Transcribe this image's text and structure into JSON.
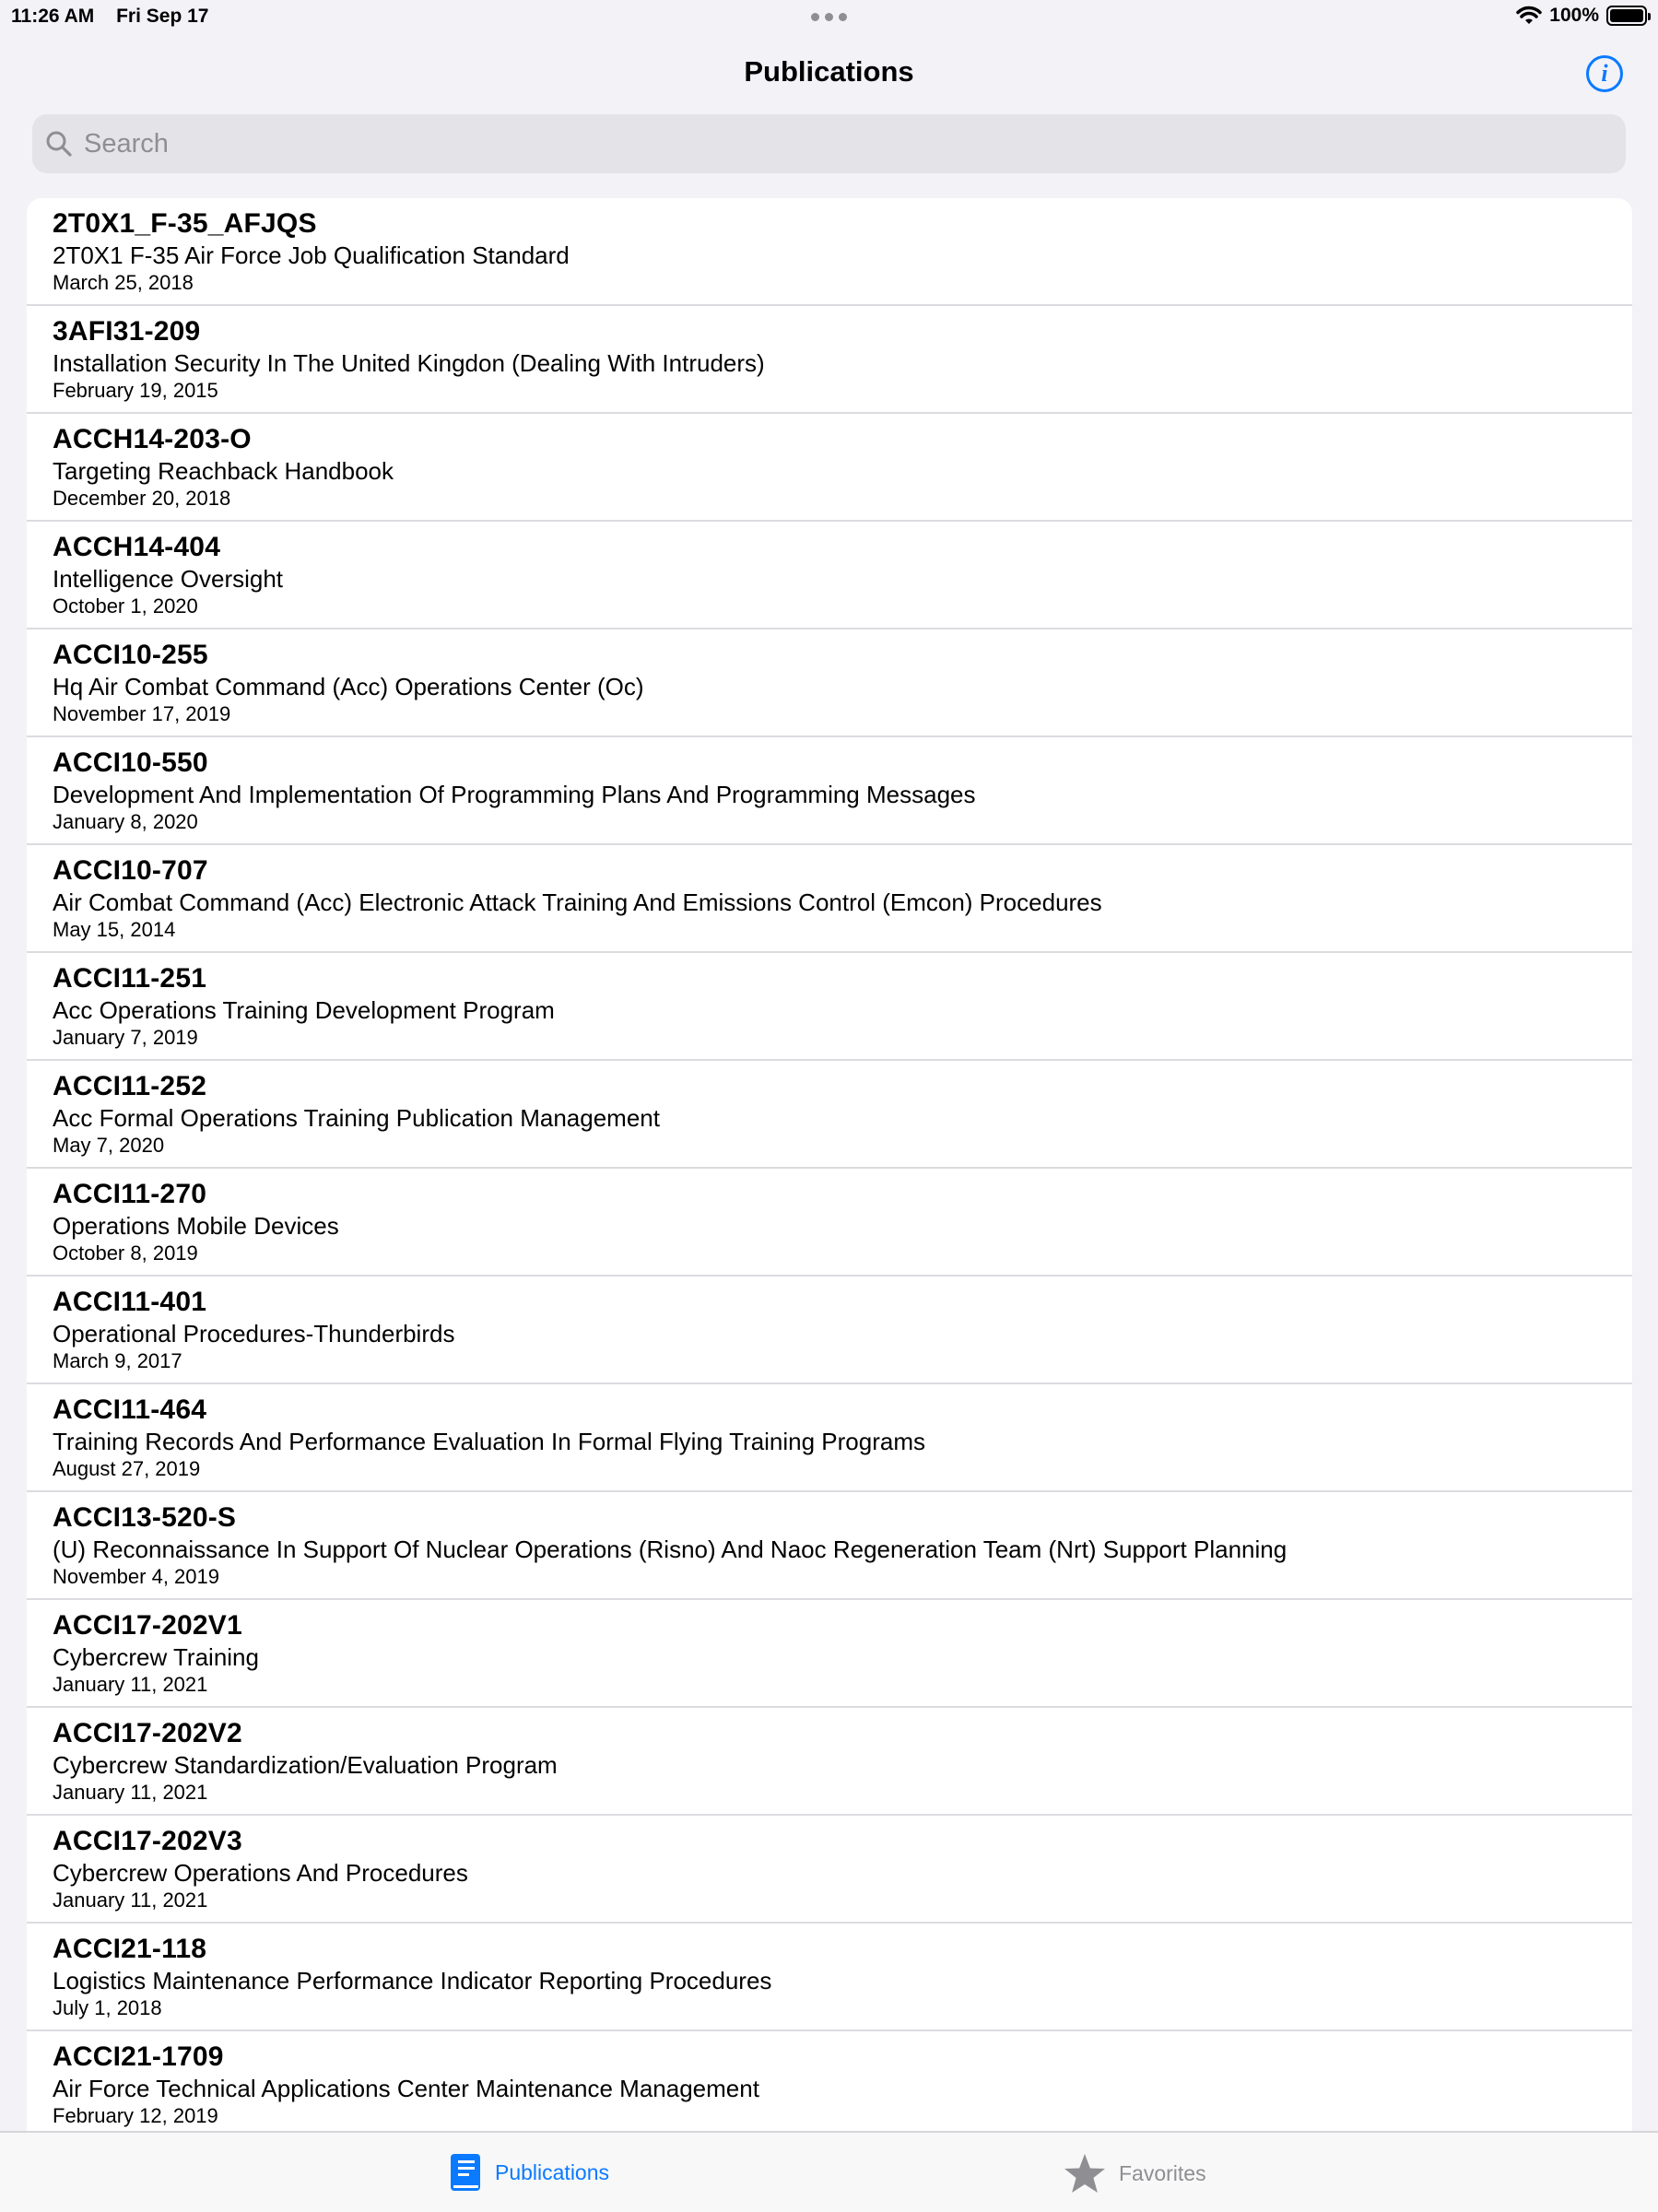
{
  "status_bar": {
    "time": "11:26 AM",
    "date": "Fri Sep 17",
    "battery": "100%"
  },
  "nav": {
    "title": "Publications"
  },
  "search": {
    "placeholder": "Search"
  },
  "publications": [
    {
      "code": "2T0X1_F-35_AFJQS",
      "title": "2T0X1 F-35 Air Force Job Qualification Standard",
      "date": "March 25, 2018"
    },
    {
      "code": "3AFI31-209",
      "title": "Installation Security In The United Kingdon (Dealing With Intruders)",
      "date": "February 19, 2015"
    },
    {
      "code": "ACCH14-203-O",
      "title": "Targeting Reachback Handbook",
      "date": "December 20, 2018"
    },
    {
      "code": "ACCH14-404",
      "title": "Intelligence Oversight",
      "date": "October 1, 2020"
    },
    {
      "code": "ACCI10-255",
      "title": "Hq Air Combat Command (Acc) Operations Center (Oc)",
      "date": "November 17, 2019"
    },
    {
      "code": "ACCI10-550",
      "title": "Development And Implementation Of Programming Plans And Programming Messages",
      "date": "January 8, 2020"
    },
    {
      "code": "ACCI10-707",
      "title": "Air Combat Command (Acc) Electronic Attack Training And Emissions Control (Emcon) Procedures",
      "date": "May 15, 2014"
    },
    {
      "code": "ACCI11-251",
      "title": "Acc Operations Training Development Program",
      "date": "January 7, 2019"
    },
    {
      "code": "ACCI11-252",
      "title": "Acc Formal Operations Training Publication Management",
      "date": "May 7, 2020"
    },
    {
      "code": "ACCI11-270",
      "title": "Operations Mobile Devices",
      "date": "October 8, 2019"
    },
    {
      "code": "ACCI11-401",
      "title": "Operational Procedures-Thunderbirds",
      "date": "March 9, 2017"
    },
    {
      "code": "ACCI11-464",
      "title": "Training Records And Performance Evaluation In Formal Flying Training Programs",
      "date": "August 27, 2019"
    },
    {
      "code": "ACCI13-520-S",
      "title": "(U) Reconnaissance In Support Of Nuclear Operations (Risno) And Naoc Regeneration Team (Nrt) Support Planning",
      "date": "November 4, 2019"
    },
    {
      "code": "ACCI17-202V1",
      "title": "Cybercrew Training",
      "date": "January 11, 2021"
    },
    {
      "code": "ACCI17-202V2",
      "title": "Cybercrew Standardization/Evaluation Program",
      "date": "January 11, 2021"
    },
    {
      "code": "ACCI17-202V3",
      "title": "Cybercrew Operations And Procedures",
      "date": "January 11, 2021"
    },
    {
      "code": "ACCI21-118",
      "title": "Logistics Maintenance Performance Indicator Reporting Procedures",
      "date": "July 1, 2018"
    },
    {
      "code": "ACCI21-1709",
      "title": "Air Force Technical Applications Center Maintenance Management",
      "date": "February 12, 2019"
    }
  ],
  "tabs": {
    "publications": {
      "label": "Publications",
      "icon": "book-icon",
      "color": "#0a7aff"
    },
    "favorites": {
      "label": "Favorites",
      "icon": "star-icon",
      "color": "#8e8e93"
    }
  },
  "colors": {
    "accent": "#0a7aff",
    "background": "#f2f2f7",
    "secondary": "#8e8e93"
  }
}
